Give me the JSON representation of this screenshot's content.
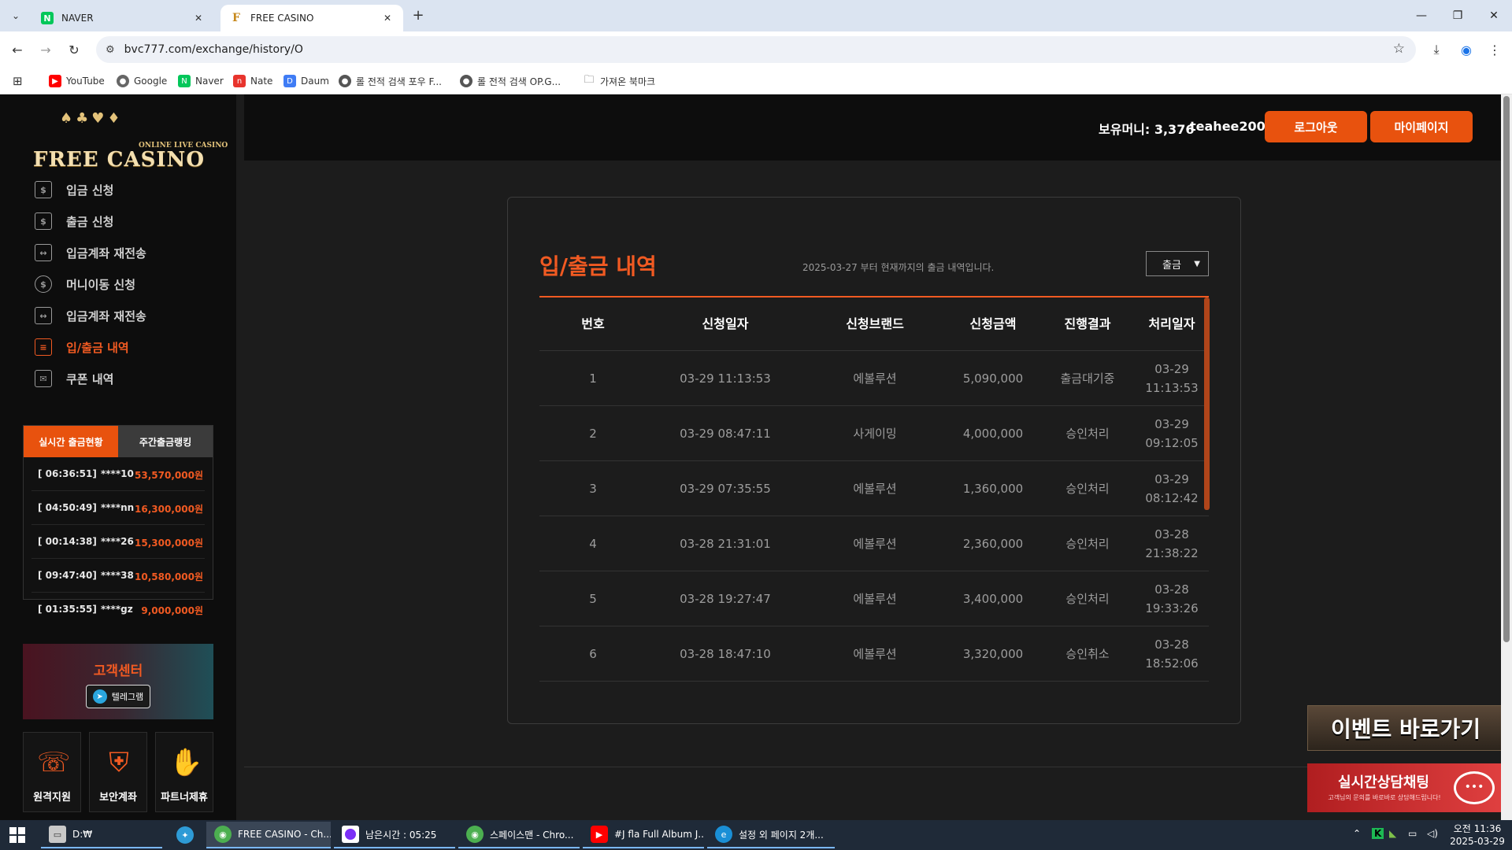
{
  "browser": {
    "tabs": [
      {
        "title": "NAVER",
        "favicon": "N"
      },
      {
        "title": "FREE CASINO",
        "favicon": "F"
      }
    ],
    "url": "bvc777.com/exchange/history/O",
    "bookmarks": [
      {
        "label": "YouTube",
        "icon": "youtube-icon"
      },
      {
        "label": "Google",
        "icon": "globe-icon"
      },
      {
        "label": "Naver",
        "icon": "naver-icon"
      },
      {
        "label": "Nate",
        "icon": "nate-icon"
      },
      {
        "label": "Daum",
        "icon": "daum-icon"
      },
      {
        "label": "롤 전적 검색 포우 F...",
        "icon": "globe-icon"
      },
      {
        "label": "롤 전적 검색 OP.G...",
        "icon": "globe-icon"
      },
      {
        "label": "가져온 북마크",
        "icon": "folder-icon"
      }
    ]
  },
  "site": {
    "logo_sub": "ONLINE LIVE CASINO",
    "logo_main": "FREE CASINO",
    "menu": [
      {
        "label": "입금 신청",
        "active": false
      },
      {
        "label": "출금 신청",
        "active": false
      },
      {
        "label": "입금계좌 재전송",
        "active": false
      },
      {
        "label": "머니이동 신청",
        "active": false
      },
      {
        "label": "입금계좌 재전송",
        "active": false
      },
      {
        "label": "입/출금 내역",
        "active": true
      },
      {
        "label": "쿠폰 내역",
        "active": false
      }
    ],
    "live_tabs": [
      "실시간 출금현황",
      "주간출금랭킹"
    ],
    "live_rows": [
      {
        "time": "[ 06:36:51]",
        "user": "****10",
        "amount": "53,570,000원"
      },
      {
        "time": "[ 04:50:49]",
        "user": "****nn",
        "amount": "16,300,000원"
      },
      {
        "time": "[ 00:14:38]",
        "user": "****26",
        "amount": "15,300,000원"
      },
      {
        "time": "[ 09:47:40]",
        "user": "****38",
        "amount": "10,580,000원"
      },
      {
        "time": "[ 01:35:55]",
        "user": "****gz",
        "amount": "9,000,000원"
      }
    ],
    "cs_title": "고객센터",
    "telegram_label": "텔레그램",
    "tiles": [
      "원격지원",
      "보안계좌",
      "파트너제휴"
    ],
    "header": {
      "money": "보유머니: 3,376",
      "username": "teahee2005",
      "logout": "로그아웃",
      "mypage": "마이페이지"
    },
    "history": {
      "title": "입/출금 내역",
      "note": "2025-03-27 부터 현재까지의 출금 내역입니다.",
      "filter": "출금",
      "columns": [
        "번호",
        "신청일자",
        "신청브랜드",
        "신청금액",
        "진행결과",
        "처리일자"
      ],
      "rows": [
        {
          "no": "1",
          "date": "03-29 11:13:53",
          "brand": "에볼루션",
          "amount": "5,090,000",
          "status": "출금대기중",
          "proc_date": "03-29",
          "proc_time": "11:13:53"
        },
        {
          "no": "2",
          "date": "03-29 08:47:11",
          "brand": "사게이밍",
          "amount": "4,000,000",
          "status": "승인처리",
          "proc_date": "03-29",
          "proc_time": "09:12:05"
        },
        {
          "no": "3",
          "date": "03-29 07:35:55",
          "brand": "에볼루션",
          "amount": "1,360,000",
          "status": "승인처리",
          "proc_date": "03-29",
          "proc_time": "08:12:42"
        },
        {
          "no": "4",
          "date": "03-28 21:31:01",
          "brand": "에볼루션",
          "amount": "2,360,000",
          "status": "승인처리",
          "proc_date": "03-28",
          "proc_time": "21:38:22"
        },
        {
          "no": "5",
          "date": "03-28 19:27:47",
          "brand": "에볼루션",
          "amount": "3,400,000",
          "status": "승인처리",
          "proc_date": "03-28",
          "proc_time": "19:33:26"
        },
        {
          "no": "6",
          "date": "03-28 18:47:10",
          "brand": "에볼루션",
          "amount": "3,320,000",
          "status": "승인취소",
          "proc_date": "03-28",
          "proc_time": "18:52:06"
        }
      ]
    },
    "event_button": "이벤트 바로가기",
    "chat_title": "실시간상담채팅",
    "chat_sub": "고객님의 문의를 바로바로 상담해드립니다!"
  },
  "taskbar": {
    "items": [
      {
        "label": "D:₩"
      },
      {
        "label": ""
      },
      {
        "label": "FREE CASINO - Ch..."
      },
      {
        "label": "남은시간 : 05:25"
      },
      {
        "label": "스페이스맨 - Chro..."
      },
      {
        "label": "#J fla Full Album J..."
      },
      {
        "label": "설정 외 페이지 2개..."
      }
    ],
    "time": "오전 11:36",
    "date": "2025-03-29"
  },
  "colors": {
    "accent": "#f15a22",
    "button": "#e8520e",
    "sidebar": "#0d0d0d",
    "page": "#1c1c1c"
  }
}
